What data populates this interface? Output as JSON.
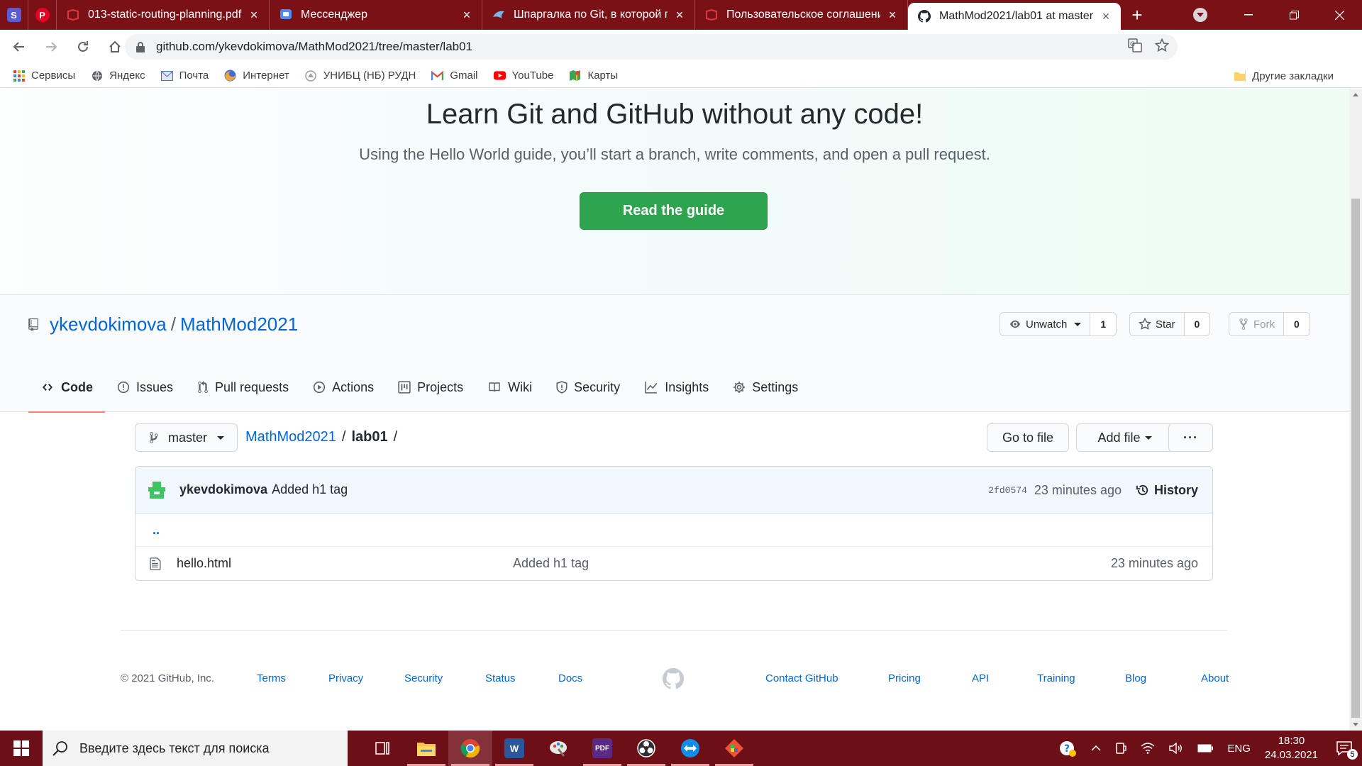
{
  "browser": {
    "pinned_tabs": [
      {
        "icon": "s-letter-icon",
        "glyph": "S",
        "color": "#5b5bd6"
      },
      {
        "icon": "pinterest-icon",
        "glyph": "P",
        "color": "#e60023"
      }
    ],
    "tabs": [
      {
        "title": "013-static-routing-planning.pdf",
        "icon": "pdf-icon",
        "active": false
      },
      {
        "title": "Мессенджер",
        "icon": "messenger-icon",
        "active": false
      },
      {
        "title": "Шпаргалка по Git, в которой пр",
        "icon": "bird-icon",
        "active": false
      },
      {
        "title": "Пользовательское соглашение",
        "icon": "pdf-icon",
        "active": false
      },
      {
        "title": "MathMod2021/lab01 at master",
        "icon": "github-icon",
        "active": true
      }
    ],
    "url": "github.com/ykevdokimova/MathMod2021/tree/master/lab01",
    "bookmarks": [
      {
        "label": "Сервисы",
        "icon": "apps-grid-icon"
      },
      {
        "label": "Яндекс",
        "icon": "globe-icon"
      },
      {
        "label": "Почта",
        "icon": "mail-icon"
      },
      {
        "label": "Интернет",
        "icon": "firefox-icon"
      },
      {
        "label": "УНИБЦ (НБ) РУДН",
        "icon": "library-icon"
      },
      {
        "label": "Gmail",
        "icon": "gmail-icon"
      },
      {
        "label": "YouTube",
        "icon": "youtube-icon"
      },
      {
        "label": "Карты",
        "icon": "maps-icon"
      }
    ],
    "other_bookmarks": "Другие закладки"
  },
  "hero": {
    "title": "Learn Git and GitHub without any code!",
    "subtitle": "Using the Hello World guide, you’ll start a branch, write comments, and open a pull request.",
    "button": "Read the guide"
  },
  "repo": {
    "owner": "ykevdokimova",
    "separator": "/",
    "name": "MathMod2021",
    "unwatch_label": "Unwatch",
    "unwatch_count": "1",
    "star_label": "Star",
    "star_count": "0",
    "fork_label": "Fork",
    "fork_count": "0"
  },
  "reponav": [
    {
      "label": "Code",
      "icon": "code-icon",
      "selected": true
    },
    {
      "label": "Issues",
      "icon": "issue-icon",
      "selected": false
    },
    {
      "label": "Pull requests",
      "icon": "pull-request-icon",
      "selected": false
    },
    {
      "label": "Actions",
      "icon": "play-icon",
      "selected": false
    },
    {
      "label": "Projects",
      "icon": "project-icon",
      "selected": false
    },
    {
      "label": "Wiki",
      "icon": "book-icon",
      "selected": false
    },
    {
      "label": "Security",
      "icon": "shield-icon",
      "selected": false
    },
    {
      "label": "Insights",
      "icon": "graph-icon",
      "selected": false
    },
    {
      "label": "Settings",
      "icon": "gear-icon",
      "selected": false
    }
  ],
  "filenav": {
    "branch": "master",
    "crumb_root": "MathMod2021",
    "crumb_sep": "/",
    "crumb_current": "lab01",
    "crumb_trail": "/",
    "go_to_file": "Go to file",
    "add_file": "Add file",
    "more": "···"
  },
  "commit": {
    "author": "ykevdokimova",
    "message": "Added h1 tag",
    "sha": "2fd0574",
    "age": "23 minutes ago",
    "history": "History"
  },
  "files": {
    "up": "..",
    "rows": [
      {
        "name": "hello.html",
        "message": "Added h1 tag",
        "age": "23 minutes ago"
      }
    ]
  },
  "footer": {
    "copyright": "© 2021 GitHub, Inc.",
    "left_links": [
      "Terms",
      "Privacy",
      "Security",
      "Status",
      "Docs"
    ],
    "right_links": [
      "Contact GitHub",
      "Pricing",
      "API",
      "Training",
      "Blog",
      "About"
    ]
  },
  "taskbar": {
    "search_placeholder": "Введите здесь текст для поиска",
    "apps": [
      {
        "name": "task-view-icon",
        "active": false
      },
      {
        "name": "file-explorer-icon",
        "active": false
      },
      {
        "name": "chrome-icon",
        "active": true
      },
      {
        "name": "word-icon",
        "active": false
      },
      {
        "name": "paint-icon",
        "active": false
      },
      {
        "name": "pdf-app-icon",
        "active": false
      },
      {
        "name": "obs-icon",
        "active": false
      },
      {
        "name": "teamviewer-icon",
        "active": false
      },
      {
        "name": "git-icon",
        "active": false
      }
    ],
    "language": "ENG",
    "time": "18:30",
    "date": "24.03.2021",
    "notification_count": "5"
  },
  "colors": {
    "chrome_frame": "#7a1117",
    "taskbar": "#6d0f16",
    "github_green": "#2ea44f",
    "link_blue": "#0366d6",
    "tab_underline": "#f9826c"
  }
}
